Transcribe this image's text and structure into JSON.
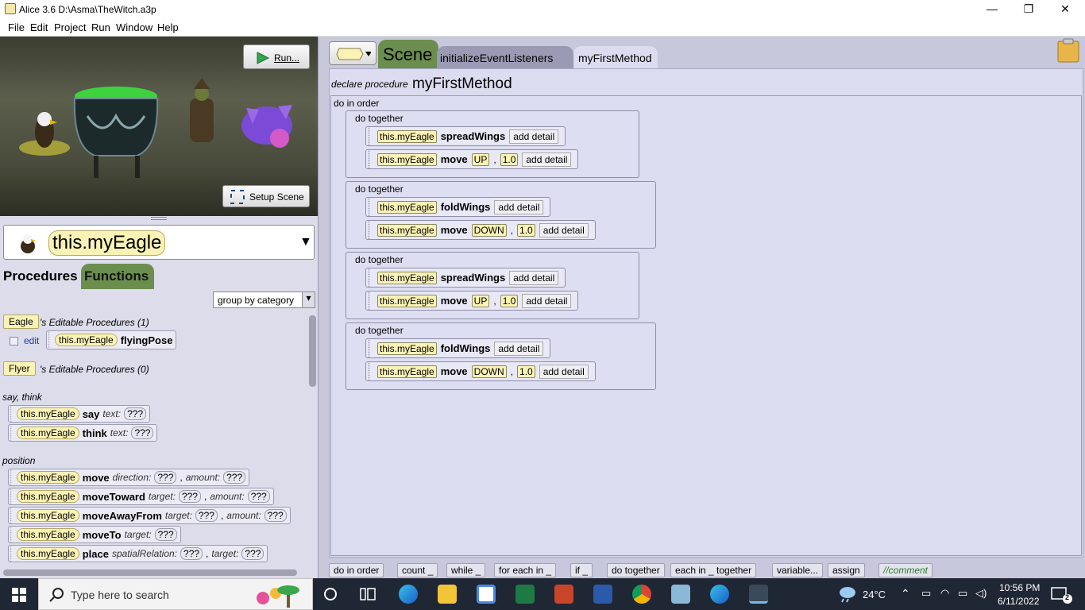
{
  "window": {
    "title": "Alice 3.6 D:\\Asma\\TheWitch.a3p",
    "min": "—",
    "max": "❐",
    "close": "✕"
  },
  "menu": [
    "File",
    "Edit",
    "Project",
    "Run",
    "Window",
    "Help"
  ],
  "scene": {
    "run_label": "Run...",
    "setup_label": "Setup Scene"
  },
  "selector": {
    "value": "this.myEagle",
    "arrow": "▼"
  },
  "left_tabs": {
    "procedures": "Procedures",
    "functions": "Functions"
  },
  "group_select": "group by category",
  "editable": {
    "eagle": {
      "type": "Eagle",
      "label": "'s Editable Procedures (1)",
      "edit": "edit",
      "target": "this.myEagle",
      "proc": "flyingPose"
    },
    "flyer": {
      "type": "Flyer",
      "label": "'s Editable Procedures (0)"
    }
  },
  "categories": {
    "say_think": "say, think",
    "position": "position"
  },
  "procs": [
    {
      "target": "this.myEagle",
      "name": "say",
      "p1": "text:",
      "v1": "???"
    },
    {
      "target": "this.myEagle",
      "name": "think",
      "p1": "text:",
      "v1": "???"
    },
    {
      "target": "this.myEagle",
      "name": "move",
      "p1": "direction:",
      "v1": "???",
      "p2": "amount:",
      "v2": "???"
    },
    {
      "target": "this.myEagle",
      "name": "moveToward",
      "p1": "target:",
      "v1": "???",
      "p2": "amount:",
      "v2": "???"
    },
    {
      "target": "this.myEagle",
      "name": "moveAwayFrom",
      "p1": "target:",
      "v1": "???",
      "p2": "amount:",
      "v2": "???"
    },
    {
      "target": "this.myEagle",
      "name": "moveTo",
      "p1": "target:",
      "v1": "???"
    },
    {
      "target": "this.myEagle",
      "name": "place",
      "p1": "spatialRelation:",
      "v1": "???",
      "p2": "target:",
      "v2": "???"
    }
  ],
  "editor_tabs": {
    "scene": "Scene",
    "init": "initializeEventListeners",
    "method": "myFirstMethod"
  },
  "declare": {
    "prefix": "declare procedure",
    "name": "myFirstMethod"
  },
  "do_in_order": "do in order",
  "blocks": [
    {
      "label": "do together",
      "rows": [
        {
          "target": "this.myEagle",
          "method": "spreadWings",
          "args": [],
          "detail": "add detail"
        },
        {
          "target": "this.myEagle",
          "method": "move",
          "args": [
            "UP",
            "1.0"
          ],
          "detail": "add detail"
        }
      ]
    },
    {
      "label": "do together",
      "rows": [
        {
          "target": "this.myEagle",
          "method": "foldWings",
          "args": [],
          "detail": "add detail"
        },
        {
          "target": "this.myEagle",
          "method": "move",
          "args": [
            "DOWN",
            "1.0"
          ],
          "detail": "add detail"
        }
      ]
    },
    {
      "label": "do together",
      "rows": [
        {
          "target": "this.myEagle",
          "method": "spreadWings",
          "args": [],
          "detail": "add detail"
        },
        {
          "target": "this.myEagle",
          "method": "move",
          "args": [
            "UP",
            "1.0"
          ],
          "detail": "add detail"
        }
      ]
    },
    {
      "label": "do together",
      "rows": [
        {
          "target": "this.myEagle",
          "method": "foldWings",
          "args": [],
          "detail": "add detail"
        },
        {
          "target": "this.myEagle",
          "method": "move",
          "args": [
            "DOWN",
            "1.0"
          ],
          "detail": "add detail"
        }
      ]
    }
  ],
  "palette": [
    "do in order",
    "count _",
    "while _",
    "for each in _",
    "if _",
    "do together",
    "each in _ together",
    "variable...",
    "assign",
    "//comment"
  ],
  "taskbar": {
    "search_placeholder": "Type here to search",
    "weather": "24°C",
    "time": "10:56 PM",
    "date": "6/11/2022",
    "notifications": "2"
  },
  "colors": {
    "accent": "#fbf3b6",
    "tab_green": "#6b8e4e",
    "editor_bg": "#dcdcf0"
  }
}
